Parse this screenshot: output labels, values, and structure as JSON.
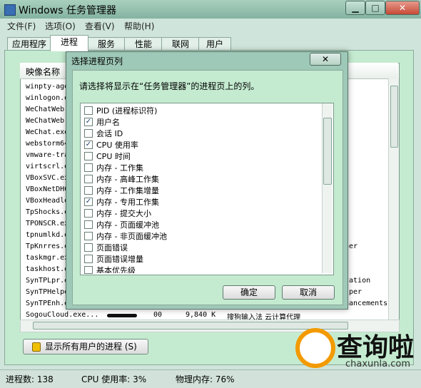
{
  "window": {
    "title": "Windows 任务管理器",
    "controls": [
      "▁",
      "□",
      "✕"
    ]
  },
  "menu": [
    "文件(F)",
    "选项(O)",
    "查看(V)",
    "帮助(H)"
  ],
  "tabs": [
    "应用程序",
    "进程",
    "服务",
    "性能",
    "联网",
    "用户"
  ],
  "list": {
    "column_header": "映像名称",
    "rows_left": [
      "winpty-age",
      "winlogon.e",
      "WeChatWeb.",
      "WeChatWeb.",
      "WeChat.exe",
      "webstorm64",
      "vmware-tra",
      "virtscrl.e",
      "VBoxSVC.ex",
      "VBoxNetDHC",
      "VBoxHeadle",
      "TpShocks.e",
      "TPONSCR.ex",
      "tpnumlkd.e",
      "TpKnrres.e",
      "taskmgr.ex",
      "taskhost.e",
      "SynTPLpr.e",
      "SynTPHelpe",
      "SynTPEnh.e"
    ],
    "rows_right": [
      "her",
      "cation",
      "lper",
      "hancements"
    ],
    "last_row": {
      "name": "SogouCloud.exe...",
      "user": "00",
      "memory": "9,840 K",
      "desc": "搜狗输入法 云计算代理"
    }
  },
  "show_all_button": "显示所有用户的进程 (S)",
  "status": {
    "processes": "进程数: 138",
    "cpu": "CPU 使用率: 3%",
    "memory": "物理内存: 76%"
  },
  "dialog": {
    "title": "选择进程页列",
    "close": "✕",
    "prompt": "请选择将显示在“任务管理器”的进程页上的列。",
    "items": [
      {
        "label": "PID (进程标识符)",
        "checked": false
      },
      {
        "label": "用户名",
        "checked": true
      },
      {
        "label": "会话 ID",
        "checked": false
      },
      {
        "label": "CPU 使用率",
        "checked": true
      },
      {
        "label": "CPU 时间",
        "checked": false
      },
      {
        "label": "内存 - 工作集",
        "checked": false
      },
      {
        "label": "内存 - 高峰工作集",
        "checked": false
      },
      {
        "label": "内存 - 工作集增量",
        "checked": false
      },
      {
        "label": "内存 - 专用工作集",
        "checked": true
      },
      {
        "label": "内存 - 提交大小",
        "checked": false
      },
      {
        "label": "内存 - 页面缓冲池",
        "checked": false
      },
      {
        "label": "内存 - 非页面缓冲池",
        "checked": false
      },
      {
        "label": "页面错误",
        "checked": false
      },
      {
        "label": "页面错误增量",
        "checked": false
      },
      {
        "label": "基本优先级",
        "checked": false
      }
    ],
    "ok": "确定",
    "cancel": "取消"
  },
  "watermark": {
    "brand": "查询啦",
    "url": "chaxunla.com"
  }
}
